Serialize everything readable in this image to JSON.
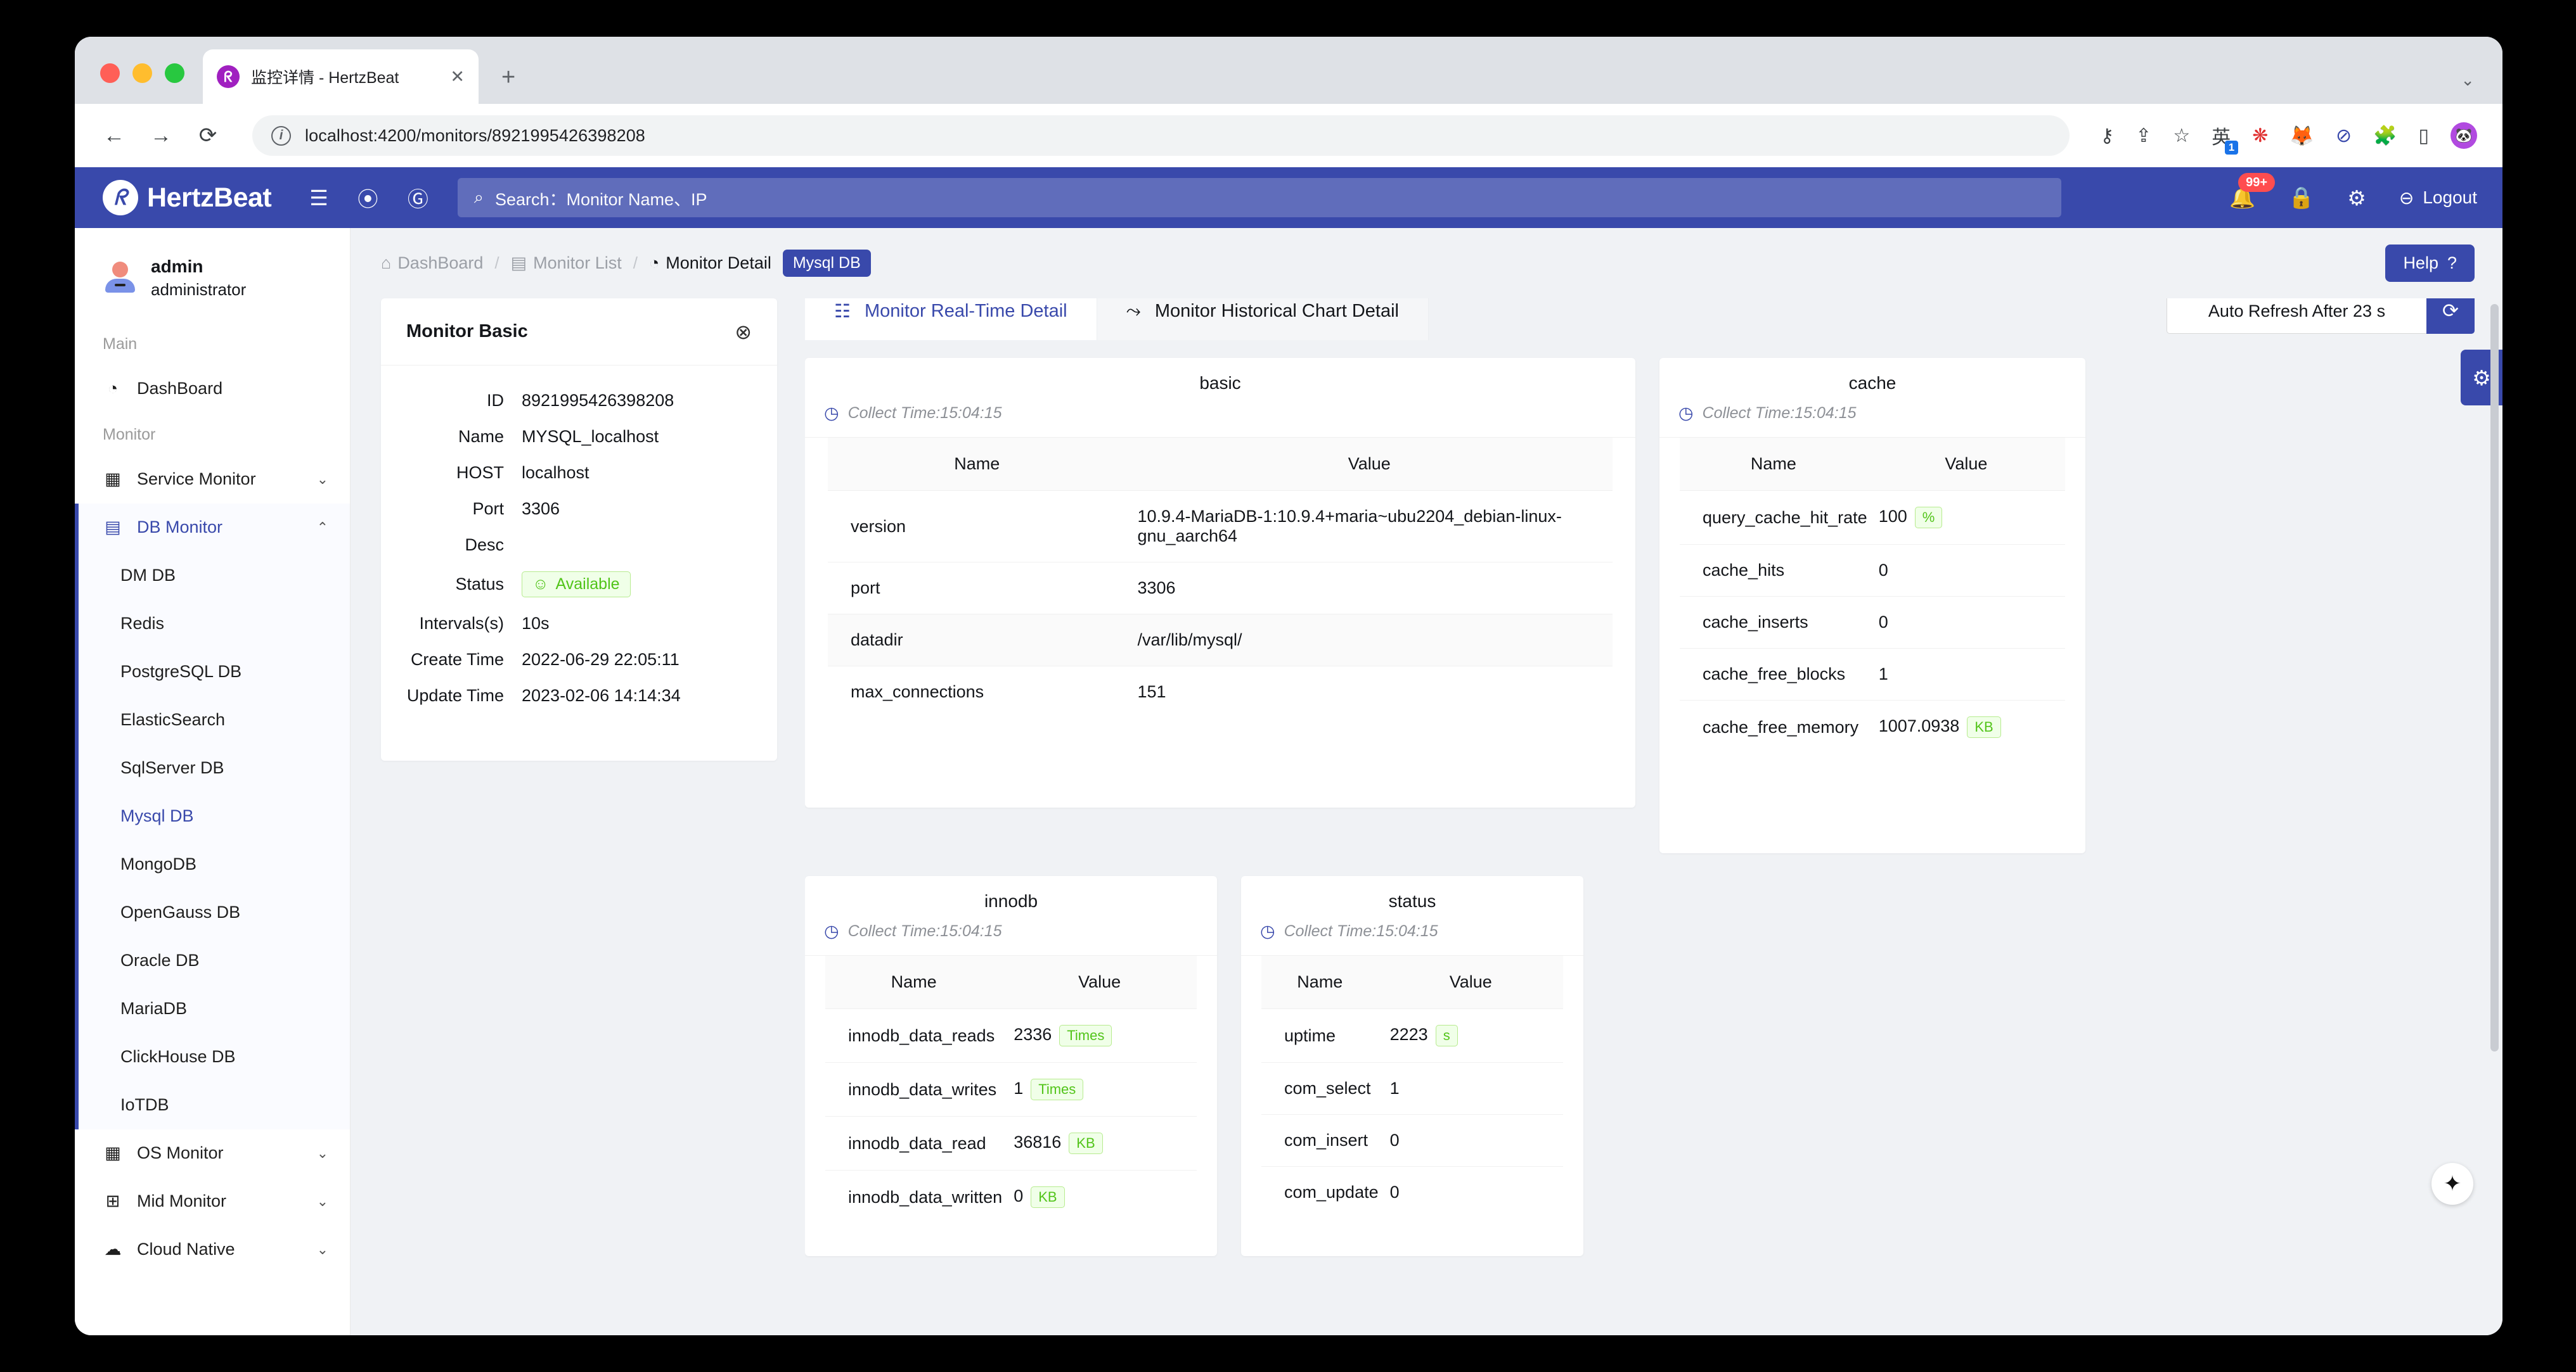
{
  "browser": {
    "tab_title": "监控详情 - HertzBeat",
    "tab_favicon": "hertzbeat-logo-icon",
    "tab_close": "✕",
    "new_tab": "+",
    "window_menu": "⌄",
    "back": "←",
    "forward": "→",
    "reload": "⟳",
    "url": "localhost:4200/monitors/8921995426398208",
    "toolbar_icons": [
      "key-icon",
      "share-icon",
      "bookmark-star-icon",
      "translate-icon",
      "extension-red-icon",
      "firefox-icon",
      "adblock-icon",
      "puzzle-extensions-icon",
      "sidebar-icon",
      "profile-avatar-icon"
    ],
    "translate_badge": "1"
  },
  "appbar": {
    "brand": "HertzBeat",
    "brand_mark": "ᖇ",
    "collapse_icon": "menu-collapse-icon",
    "github_icon": "github-icon",
    "gitee_icon": "gitee-icon",
    "search_placeholder": "Search：Monitor Name、IP",
    "search_icon": "search-icon",
    "bell_icon": "bell-icon",
    "bell_badge": "99+",
    "lock_icon": "lock-icon",
    "gear_icon": "gear-icon",
    "logout_icon": "logout-icon",
    "logout_label": "Logout"
  },
  "sidebar": {
    "user": {
      "name": "admin",
      "role": "administrator"
    },
    "sections": [
      {
        "label": "Main",
        "items": [
          {
            "label": "DashBoard",
            "icon": "dashboard-icon",
            "expandable": false
          }
        ]
      },
      {
        "label": "Monitor",
        "items": [
          {
            "label": "Service Monitor",
            "icon": "grid-icon",
            "expandable": true,
            "chevron": "⌄"
          },
          {
            "label": "DB Monitor",
            "icon": "database-icon",
            "expandable": true,
            "chevron": "⌃",
            "active": true
          }
        ]
      }
    ],
    "db_children": [
      "DM DB",
      "Redis",
      "PostgreSQL DB",
      "ElasticSearch",
      "SqlServer DB",
      "Mysql DB",
      "MongoDB",
      "OpenGauss DB",
      "Oracle DB",
      "MariaDB",
      "ClickHouse DB",
      "IoTDB"
    ],
    "db_active_child": "Mysql DB",
    "tail_items": [
      {
        "label": "OS Monitor",
        "icon": "grid-icon",
        "chevron": "⌄"
      },
      {
        "label": "Mid Monitor",
        "icon": "middleware-icon",
        "chevron": "⌄"
      },
      {
        "label": "Cloud Native",
        "icon": "cloud-icon",
        "chevron": "⌄"
      }
    ]
  },
  "breadcrumb": {
    "items": [
      {
        "label": "DashBoard",
        "icon": "home-icon"
      },
      {
        "label": "Monitor List",
        "icon": "list-icon"
      },
      {
        "label": "Monitor Detail",
        "icon": "pie-icon",
        "current": true
      }
    ],
    "separator": "/",
    "tag": "Mysql DB"
  },
  "help_button": {
    "label": "Help",
    "icon": "question-circle-icon"
  },
  "monitor_basic": {
    "title": "Monitor Basic",
    "close_icon": "close-circle-icon",
    "fields": [
      {
        "key": "ID",
        "value": "8921995426398208"
      },
      {
        "key": "Name",
        "value": "MYSQL_localhost"
      },
      {
        "key": "HOST",
        "value": "localhost"
      },
      {
        "key": "Port",
        "value": "3306"
      },
      {
        "key": "Desc",
        "value": ""
      },
      {
        "key": "Status",
        "value": "Available",
        "badge": true,
        "badge_icon": "smile-icon"
      },
      {
        "key": "Intervals(s)",
        "value": "10s"
      },
      {
        "key": "Create Time",
        "value": "2022-06-29 22:05:11"
      },
      {
        "key": "Update Time",
        "value": "2023-02-06 14:14:34"
      }
    ]
  },
  "tabs": [
    {
      "label": "Monitor Real-Time Detail",
      "icon": "detail-list-icon",
      "selected": true
    },
    {
      "label": "Monitor Historical Chart Detail",
      "icon": "line-chart-icon",
      "selected": false
    }
  ],
  "auto_refresh": {
    "text": "Auto Refresh After 23 s",
    "button_icon": "refresh-icon"
  },
  "metric_cards": [
    {
      "name": "basic",
      "collect_time": "Collect Time:15:04:15",
      "columns": [
        "Name",
        "Value"
      ],
      "rows": [
        {
          "name": "version",
          "value": "10.9.4-MariaDB-1:10.9.4+maria~ubu2204_debian-linux-gnu_aarch64",
          "unit": ""
        },
        {
          "name": "port",
          "value": "3306",
          "unit": ""
        },
        {
          "name": "datadir",
          "value": "/var/lib/mysql/",
          "unit": ""
        },
        {
          "name": "max_connections",
          "value": "151",
          "unit": ""
        }
      ]
    },
    {
      "name": "cache",
      "collect_time": "Collect Time:15:04:15",
      "columns": [
        "Name",
        "Value"
      ],
      "rows": [
        {
          "name": "query_cache_hit_rate",
          "value": "100",
          "unit": "%"
        },
        {
          "name": "cache_hits",
          "value": "0",
          "unit": ""
        },
        {
          "name": "cache_inserts",
          "value": "0",
          "unit": ""
        },
        {
          "name": "cache_free_blocks",
          "value": "1",
          "unit": ""
        },
        {
          "name": "cache_free_memory",
          "value": "1007.0938",
          "unit": "KB"
        }
      ]
    },
    {
      "name": "innodb",
      "collect_time": "Collect Time:15:04:15",
      "columns": [
        "Name",
        "Value"
      ],
      "rows": [
        {
          "name": "innodb_data_reads",
          "value": "2336",
          "unit": "Times"
        },
        {
          "name": "innodb_data_writes",
          "value": "1",
          "unit": "Times"
        },
        {
          "name": "innodb_data_read",
          "value": "36816",
          "unit": "KB"
        },
        {
          "name": "innodb_data_written",
          "value": "0",
          "unit": "KB"
        }
      ]
    },
    {
      "name": "status",
      "collect_time": "Collect Time:15:04:15",
      "columns": [
        "Name",
        "Value"
      ],
      "rows": [
        {
          "name": "uptime",
          "value": "2223",
          "unit": "s"
        },
        {
          "name": "com_select",
          "value": "1",
          "unit": ""
        },
        {
          "name": "com_insert",
          "value": "0",
          "unit": ""
        },
        {
          "name": "com_update",
          "value": "0",
          "unit": ""
        }
      ]
    }
  ],
  "float_settings": {
    "icon": "gear-icon"
  },
  "cursor": {
    "icon": "magic-wand-icon"
  },
  "colors": {
    "primary": "#3949ab",
    "badge_red": "#ff4d4f",
    "success": "#52c41a",
    "page_bg": "#f0f2f5"
  }
}
